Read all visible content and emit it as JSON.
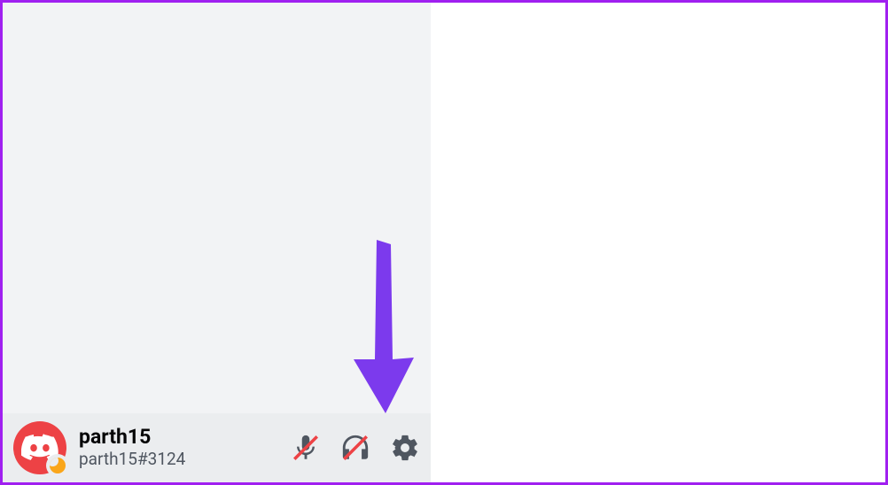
{
  "user": {
    "username": "parth15",
    "tag": "parth15#3124",
    "status": "idle"
  },
  "panel": {
    "mic": "muted",
    "deafen": "on"
  },
  "annotation": {
    "target": "settings-button"
  }
}
